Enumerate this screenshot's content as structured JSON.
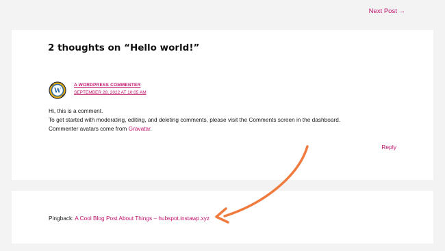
{
  "navigation": {
    "next_post": "Next Post →"
  },
  "comments": {
    "title": "2 thoughts on “Hello world!”",
    "comment": {
      "author": "A WordPress Commenter",
      "date": "September 28, 2022 at 10:05 am",
      "line1": "Hi, this is a comment.",
      "line2": "To get started with moderating, editing, and deleting comments, please visit the Comments screen in the dashboard.",
      "line3_prefix": "Commenter avatars come from ",
      "gravatar_link": "Gravatar",
      "line3_suffix": ".",
      "reply": "Reply"
    }
  },
  "pingback": {
    "label": "Pingback: ",
    "link": "A Cool Blog Post About Things – hubspot.instawp.xyz"
  },
  "colors": {
    "accent": "#c0116b",
    "annotation_arrow": "#f07b3f",
    "background": "#f3f3f3",
    "card": "#ffffff"
  },
  "icons": {
    "avatar": "wordpress-logo-avatar",
    "arrow": "curved-arrow-annotation"
  }
}
